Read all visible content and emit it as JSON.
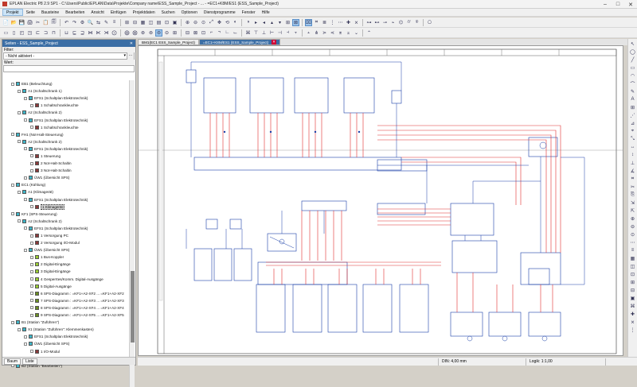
{
  "window": {
    "title": "EPLAN Electric P8 2.9 SP1 - C:\\Users\\Public\\EPLAN\\Data\\Projekte\\Company name\\ESS_Sample_Project - ... - =EC1+K8M/ES1 (ESS_Sample_Project)",
    "minimize": "–",
    "maximize": "□",
    "close": "✕"
  },
  "menu": [
    "Projekt",
    "Seite",
    "Bausteine",
    "Bearbeiten",
    "Ansicht",
    "Einfügen",
    "Projektdaten",
    "Suchen",
    "Optionen",
    "Dienstprogramme",
    "Fenster",
    "Hilfe"
  ],
  "toolbar1": [
    "📄",
    "📂",
    "💾",
    "🖨",
    "✂",
    "📋",
    "🗐",
    "↶",
    "↷",
    "⚙",
    "🔍",
    "⇆",
    "✎",
    "≡",
    "⊞",
    "⊟",
    "▦",
    "◫",
    "▤",
    "⊡",
    "▣",
    "⊕",
    "⊖",
    "⊙",
    "⤢",
    "✥",
    "⟲",
    "◐",
    "◑",
    "▸",
    "◂",
    "▴",
    "▾",
    "⊞",
    "⊠",
    "⌧",
    "⌗",
    "≣",
    "⋮",
    "⋯",
    "✚",
    "⨯",
    "⊶",
    "⊷",
    "⊸",
    "⌁",
    "⌬",
    "⌭",
    "⍟",
    "⎔"
  ],
  "toolbar2": [
    "▭",
    "▯",
    "◰",
    "◳",
    "⊏",
    "⊐",
    "⊓",
    "⊔",
    "⊑",
    "⊒",
    "⋈",
    "⋉",
    "⋊",
    "⨀",
    "⨁",
    "⨂",
    "⊛",
    "⊚",
    "⊜",
    "⊝",
    "⊞",
    "⊟",
    "⊠",
    "⊡",
    "⌐",
    "¬",
    "∟",
    "⌙",
    "⌘",
    "⊤",
    "⊥",
    "⊢",
    "⊣",
    "⫞",
    "⫟",
    "⫠",
    "⋔",
    "⋗",
    "⋖",
    "⌆",
    "⌅",
    "⌄",
    "⌃"
  ],
  "left_panel": {
    "title": "Seiten - ESS_Sample_Project",
    "close": "✕",
    "filter_label": "Filter:",
    "filter_value": "- Nicht aktiviert -",
    "value_label": "Wert:",
    "tabs": [
      "Baum",
      "Liste"
    ],
    "tree": [
      {
        "indent": 1,
        "icon": "#3fb6c9",
        "text": "EB1 (Beleuchtung)"
      },
      {
        "indent": 2,
        "icon": "#3fb6c9",
        "text": "A1 (Schaltschrank 1)"
      },
      {
        "indent": 3,
        "icon": "#3fb6c9",
        "text": "EFS1 (Schaltplan Elektrotechnik)"
      },
      {
        "indent": 4,
        "icon": "#8b3a3a",
        "text": "1 Schaltschrankleuchte"
      },
      {
        "indent": 2,
        "icon": "#3fb6c9",
        "text": "A2 (Schaltschrank 2)"
      },
      {
        "indent": 3,
        "icon": "#3fb6c9",
        "text": "EFS1 (Schaltplan Elektrotechnik)"
      },
      {
        "indent": 4,
        "icon": "#8b3a3a",
        "text": "1 Schaltschrankleuchte"
      },
      {
        "indent": 1,
        "icon": "#3fb6c9",
        "text": "FH1 (Not-Halt-Steuerung)"
      },
      {
        "indent": 2,
        "icon": "#3fb6c9",
        "text": "A2 (Schaltschrank 2)"
      },
      {
        "indent": 3,
        "icon": "#3fb6c9",
        "text": "EFS1 (Schaltplan Elektrotechnik)"
      },
      {
        "indent": 4,
        "icon": "#8b3a3a",
        "text": "1 Steuerung"
      },
      {
        "indent": 4,
        "icon": "#8b3a3a",
        "text": "2 Not-Halt-Schaltin"
      },
      {
        "indent": 4,
        "icon": "#8b3a3a",
        "text": "3 Not-Halt-Schaltin"
      },
      {
        "indent": 3,
        "icon": "#3fb6c9",
        "text": "ÜW1 (Übersicht SPS)"
      },
      {
        "indent": 1,
        "icon": "#3fb6c9",
        "text": "EC1 (Kühlung)"
      },
      {
        "indent": 2,
        "icon": "#3fb6c9",
        "text": "A1 (Klimagerät)"
      },
      {
        "indent": 3,
        "icon": "#3fb6c9",
        "text": "EFS1 (Schaltplan Elektrotechnik)"
      },
      {
        "indent": 4,
        "icon": "#8b3a3a",
        "text": "1 Klimagerät",
        "selected": true
      },
      {
        "indent": 1,
        "icon": "#3fb6c9",
        "text": "KF1 (SPS-Steuerung)"
      },
      {
        "indent": 2,
        "icon": "#3fb6c9",
        "text": "A2 (Schaltschrank 2)"
      },
      {
        "indent": 3,
        "icon": "#3fb6c9",
        "text": "EFS1 (Schaltplan Elektrotechnik)"
      },
      {
        "indent": 4,
        "icon": "#8b3a3a",
        "text": "1 Versorgung PC"
      },
      {
        "indent": 4,
        "icon": "#8b3a3a",
        "text": "2 Versorgung I/O-Modul"
      },
      {
        "indent": 3,
        "icon": "#3fb6c9",
        "text": "ÜW1 (Übersicht SPS)"
      },
      {
        "indent": 4,
        "icon": "#9acd32",
        "text": "1 Bus-Koppler"
      },
      {
        "indent": 4,
        "icon": "#9acd32",
        "text": "2 Digital-Eingänge"
      },
      {
        "indent": 4,
        "icon": "#9acd32",
        "text": "3 Digital-Eingänge"
      },
      {
        "indent": 4,
        "icon": "#9acd32",
        "text": "4 Gesperrtes/Komm. Digital-Ausgänge"
      },
      {
        "indent": 4,
        "icon": "#9acd32",
        "text": "5 Digital-Ausgänge"
      },
      {
        "indent": 4,
        "icon": "#6b8e23",
        "text": "6 SPS-Diagramm : =KF1+A2-XF2 ... =KF1+A2-XF2"
      },
      {
        "indent": 4,
        "icon": "#6b8e23",
        "text": "7 SPS-Diagramm : =KF1+A2-XF3 ... =KF1+A2-XF3"
      },
      {
        "indent": 4,
        "icon": "#6b8e23",
        "text": "8 SPS-Diagramm : =KF1+A2-XF4 ... =KF1+A2-XF4"
      },
      {
        "indent": 4,
        "icon": "#6b8e23",
        "text": "9 SPS-Diagramm : =KF1+A2-XF5 ... =KF1+A2-XF5"
      },
      {
        "indent": 1,
        "icon": "#3fb6c9",
        "text": "B1 (Station \"Zuführen\")"
      },
      {
        "indent": 2,
        "icon": "#3fb6c9",
        "text": "X1 (Station \"Zuführen\": Klemmenkasten)"
      },
      {
        "indent": 3,
        "icon": "#3fb6c9",
        "text": "EFS1 (Schaltplan Elektrotechnik)"
      },
      {
        "indent": 3,
        "icon": "#3fb6c9",
        "text": "ÜW1 (Übersicht SPS)"
      },
      {
        "indent": 4,
        "icon": "#8b3a3a",
        "text": "1 I/O-Modul"
      },
      {
        "indent": 4,
        "icon": "#6b8e23",
        "text": "2 SPS-Diagramm : =KF1+B1-X1-KF1 ... =KF1+B1"
      },
      {
        "indent": 1,
        "icon": "#3fb6c9",
        "text": "B2 (Station \"Bearbeiten\")"
      }
    ]
  },
  "doc_tabs": [
    {
      "label": "BM1(EC1 ESS_Sample_Project)"
    },
    {
      "label": "=EC1+K8M/ES1 (ESS_Sample_Project)",
      "active": true,
      "close": "✕"
    }
  ],
  "status": {
    "coords": "DIN: 4,00 mm",
    "scale": "Logik: 1:1,00",
    "zoom": ""
  },
  "right_tools": [
    "↖",
    "◯",
    "╱",
    "▭",
    "◠",
    "⌒",
    "✎",
    "A",
    "⊞",
    "⋰",
    "⊿",
    "⌖",
    "⤡",
    "↔",
    "↕",
    "⊥",
    "∡",
    "⌗",
    "✂",
    "⎘",
    "⇲",
    "⇱",
    "⊕",
    "⊖",
    "⊙",
    "⋯",
    "≡",
    "▦",
    "◫",
    "⊡",
    "⊞",
    "⊟",
    "▣",
    "⌘",
    "✚",
    "⨯",
    "⋮"
  ]
}
